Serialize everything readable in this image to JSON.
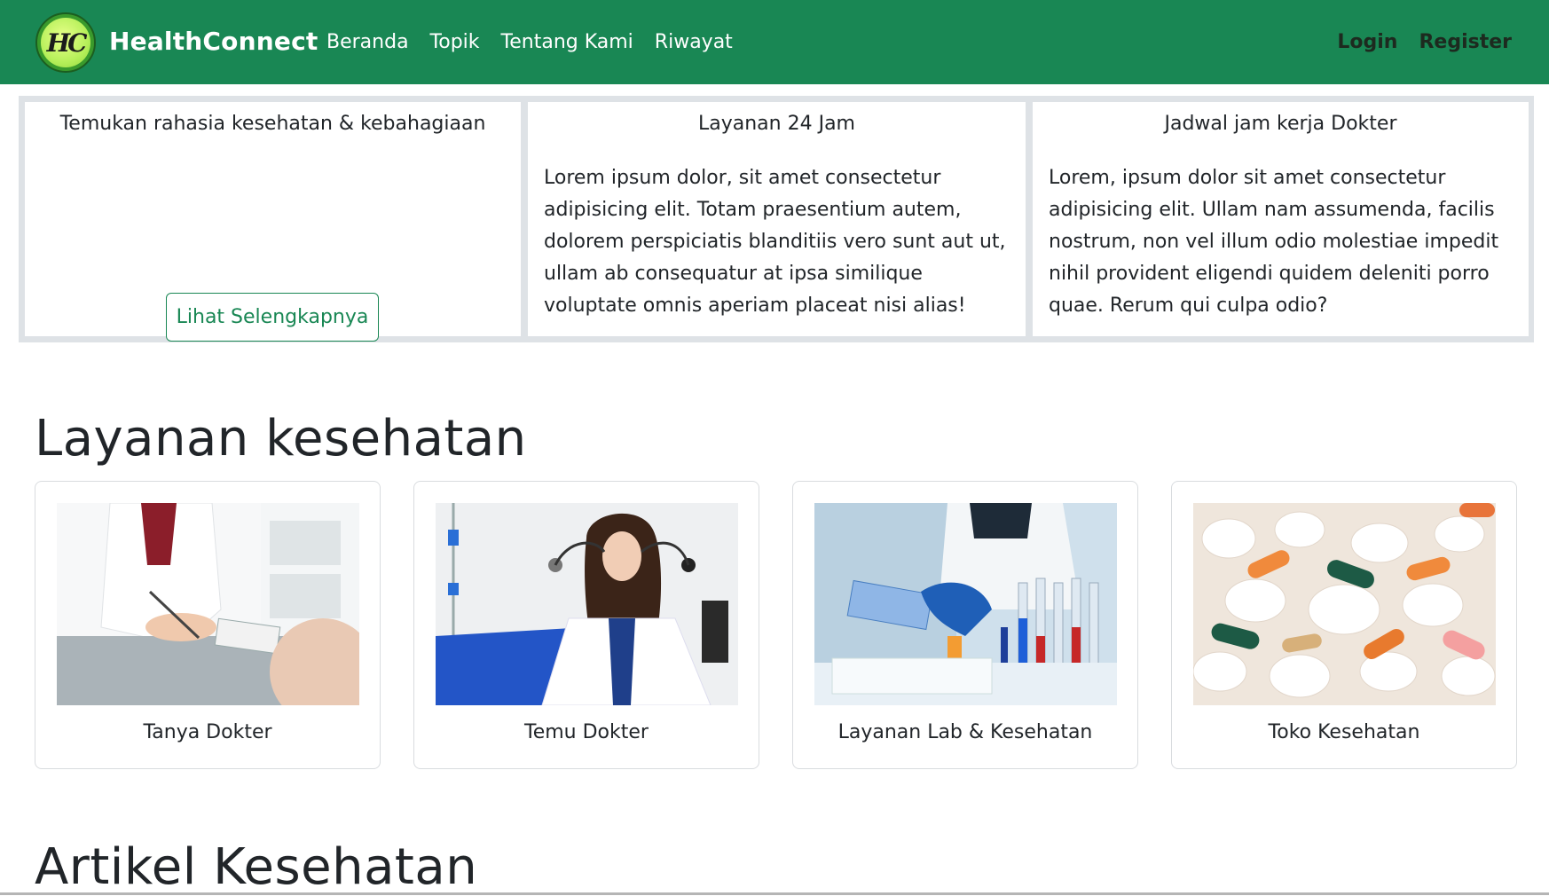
{
  "navbar": {
    "brand": "HealthConnect",
    "logo_text": "HC",
    "links": [
      "Beranda",
      "Topik",
      "Tentang Kami",
      "Riwayat"
    ],
    "auth": [
      "Login",
      "Register"
    ],
    "bg_color": "#198754"
  },
  "info": {
    "col1": {
      "title": "Temukan rahasia kesehatan & kebahagiaan",
      "button": "Lihat Selengkapnya"
    },
    "col2": {
      "title": "Layanan 24 Jam",
      "body": "Lorem ipsum dolor, sit amet consectetur adipisicing elit. Totam praesentium autem, dolorem perspiciatis blanditiis vero sunt aut ut, ullam ab consequatur at ipsa similique voluptate omnis aperiam placeat nisi alias!"
    },
    "col3": {
      "title": "Jadwal jam kerja Dokter",
      "body": "Lorem, ipsum dolor sit amet consectetur adipisicing elit. Ullam nam assumenda, facilis nostrum, non vel illum odio molestiae impedit nihil provident eligendi quidem deleniti porro quae. Rerum qui culpa odio?"
    }
  },
  "services": {
    "title": "Layanan kesehatan",
    "cards": [
      {
        "label": "Tanya Dokter",
        "image": "doctor-writing-photo"
      },
      {
        "label": "Temu Dokter",
        "image": "female-doctor-stethoscope-photo"
      },
      {
        "label": "Layanan Lab & Kesehatan",
        "image": "lab-test-tubes-photo"
      },
      {
        "label": "Toko Kesehatan",
        "image": "pills-capsules-photo"
      }
    ]
  },
  "articles": {
    "title": "Artikel Kesehatan"
  }
}
